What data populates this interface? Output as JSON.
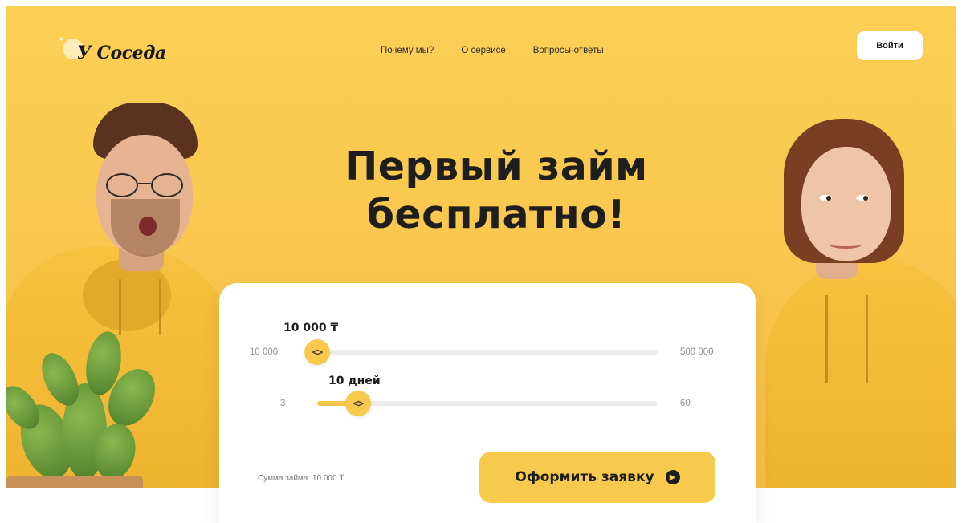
{
  "header": {
    "logo_text": "У Соседа",
    "nav": [
      {
        "label": "Почему мы?"
      },
      {
        "label": "О сервисе"
      },
      {
        "label": "Вопросы-ответы"
      }
    ],
    "login_label": "Войти"
  },
  "hero": {
    "headline_line1": "Первый займ",
    "headline_line2": "бесплатно!"
  },
  "calculator": {
    "amount": {
      "value_label": "10 000 ₸",
      "min_label": "10 000",
      "max_label": "500 000",
      "fraction": 0.0
    },
    "term": {
      "value_label": "10 дней",
      "min_label": "3",
      "max_label": "60",
      "fraction": 0.12
    },
    "thumb_glyph": "<>",
    "summary": "Сумма займа: 10 000 ₸",
    "submit_label": "Оформить заявку",
    "submit_icon": "arrow-right-circle-icon"
  },
  "colors": {
    "hero_bg": "#f9c64d",
    "accent": "#f7c94c",
    "text_dark": "#1e1e1e"
  }
}
